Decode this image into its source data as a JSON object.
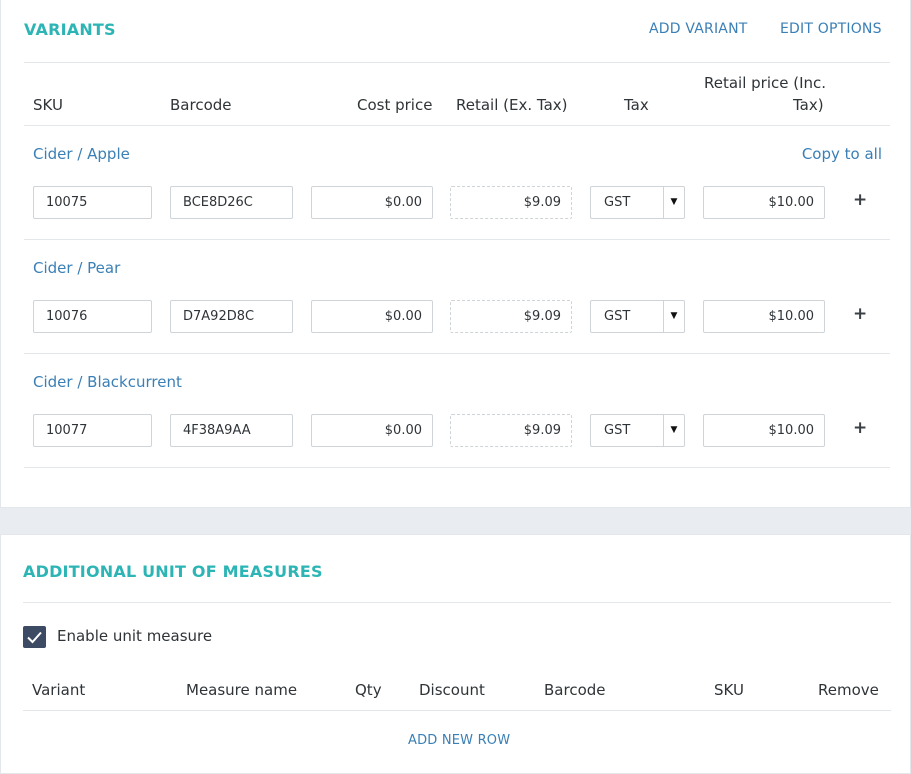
{
  "variants": {
    "title": "VARIANTS",
    "add_variant": "ADD VARIANT",
    "edit_options": "EDIT OPTIONS",
    "headers": {
      "sku": "SKU",
      "barcode": "Barcode",
      "cost": "Cost price",
      "retail_ex": "Retail (Ex. Tax)",
      "tax": "Tax",
      "retail_inc_1": "Retail price (Inc.",
      "retail_inc_2": "Tax)"
    },
    "copy_to_all": "Copy to all",
    "rows": [
      {
        "name": "Cider / Apple",
        "sku": "10075",
        "barcode": "BCE8D26C",
        "cost": "$0.00",
        "retail_ex": "$9.09",
        "tax": "GST",
        "retail_inc": "$10.00"
      },
      {
        "name": "Cider / Pear",
        "sku": "10076",
        "barcode": "D7A92D8C",
        "cost": "$0.00",
        "retail_ex": "$9.09",
        "tax": "GST",
        "retail_inc": "$10.00"
      },
      {
        "name": "Cider / Blackcurrent",
        "sku": "10077",
        "barcode": "4F38A9AA",
        "cost": "$0.00",
        "retail_ex": "$9.09",
        "tax": "GST",
        "retail_inc": "$10.00"
      }
    ]
  },
  "uom": {
    "title": "ADDITIONAL UNIT OF MEASURES",
    "enable_label": "Enable unit measure",
    "enabled": true,
    "headers": {
      "variant": "Variant",
      "measure_name": "Measure name",
      "qty": "Qty",
      "discount": "Discount",
      "barcode": "Barcode",
      "sku": "SKU",
      "remove": "Remove"
    },
    "add_new_row": "ADD NEW ROW"
  },
  "icons": {
    "plus": "plus-icon",
    "caret": "caret-down-icon",
    "check": "check-icon"
  },
  "colors": {
    "section_title": "#2db4b4",
    "link": "#3a7fb5",
    "checkbox": "#3d4a63"
  }
}
